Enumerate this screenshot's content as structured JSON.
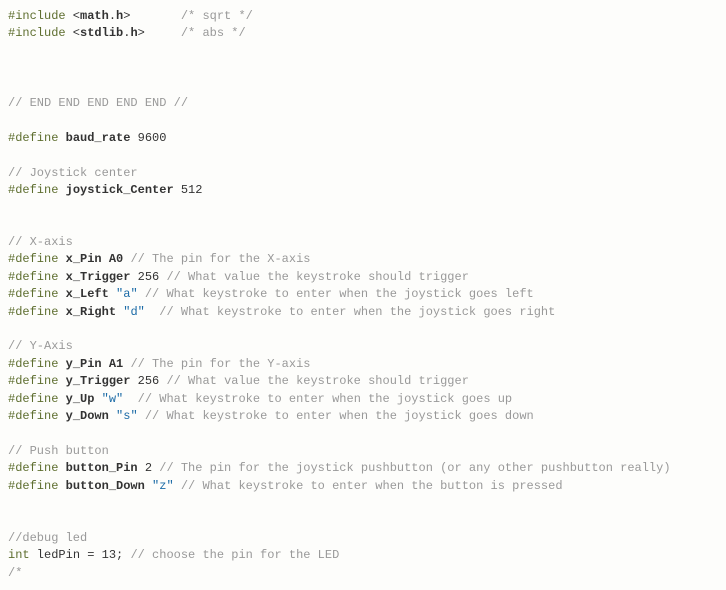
{
  "lines": [
    {
      "parts": [
        {
          "cls": "kw",
          "t": "#include"
        },
        {
          "cls": "reg",
          "t": " <"
        },
        {
          "cls": "id",
          "t": "math"
        },
        {
          "cls": "reg",
          "t": "."
        },
        {
          "cls": "id",
          "t": "h"
        },
        {
          "cls": "reg",
          "t": ">       "
        },
        {
          "cls": "cm",
          "t": "/* sqrt */"
        }
      ]
    },
    {
      "parts": [
        {
          "cls": "kw",
          "t": "#include"
        },
        {
          "cls": "reg",
          "t": " <"
        },
        {
          "cls": "id",
          "t": "stdlib"
        },
        {
          "cls": "reg",
          "t": "."
        },
        {
          "cls": "id",
          "t": "h"
        },
        {
          "cls": "reg",
          "t": ">     "
        },
        {
          "cls": "cm",
          "t": "/* abs */"
        }
      ]
    },
    {
      "parts": []
    },
    {
      "parts": []
    },
    {
      "parts": []
    },
    {
      "parts": [
        {
          "cls": "cm",
          "t": "// END END END END END //"
        }
      ]
    },
    {
      "parts": []
    },
    {
      "parts": [
        {
          "cls": "kw",
          "t": "#define"
        },
        {
          "cls": "reg",
          "t": " "
        },
        {
          "cls": "id",
          "t": "baud_rate"
        },
        {
          "cls": "reg",
          "t": " 9600"
        }
      ]
    },
    {
      "parts": []
    },
    {
      "parts": [
        {
          "cls": "cm",
          "t": "// Joystick center"
        }
      ]
    },
    {
      "parts": [
        {
          "cls": "kw",
          "t": "#define"
        },
        {
          "cls": "reg",
          "t": " "
        },
        {
          "cls": "id",
          "t": "joystick_Center"
        },
        {
          "cls": "reg",
          "t": " 512"
        }
      ]
    },
    {
      "parts": []
    },
    {
      "parts": []
    },
    {
      "parts": [
        {
          "cls": "cm",
          "t": "// X-axis"
        }
      ]
    },
    {
      "parts": [
        {
          "cls": "kw",
          "t": "#define"
        },
        {
          "cls": "reg",
          "t": " "
        },
        {
          "cls": "id",
          "t": "x_Pin"
        },
        {
          "cls": "reg",
          "t": " "
        },
        {
          "cls": "id",
          "t": "A0"
        },
        {
          "cls": "reg",
          "t": " "
        },
        {
          "cls": "cm",
          "t": "// The pin for the X-axis"
        }
      ]
    },
    {
      "parts": [
        {
          "cls": "kw",
          "t": "#define"
        },
        {
          "cls": "reg",
          "t": " "
        },
        {
          "cls": "id",
          "t": "x_Trigger"
        },
        {
          "cls": "reg",
          "t": " 256 "
        },
        {
          "cls": "cm",
          "t": "// What value the keystroke should trigger"
        }
      ]
    },
    {
      "parts": [
        {
          "cls": "kw",
          "t": "#define"
        },
        {
          "cls": "reg",
          "t": " "
        },
        {
          "cls": "id",
          "t": "x_Left"
        },
        {
          "cls": "reg",
          "t": " "
        },
        {
          "cls": "str",
          "t": "\"a\""
        },
        {
          "cls": "reg",
          "t": " "
        },
        {
          "cls": "cm",
          "t": "// What keystroke to enter when the joystick goes left"
        }
      ]
    },
    {
      "parts": [
        {
          "cls": "kw",
          "t": "#define"
        },
        {
          "cls": "reg",
          "t": " "
        },
        {
          "cls": "id",
          "t": "x_Right"
        },
        {
          "cls": "reg",
          "t": " "
        },
        {
          "cls": "str",
          "t": "\"d\""
        },
        {
          "cls": "reg",
          "t": "  "
        },
        {
          "cls": "cm",
          "t": "// What keystroke to enter when the joystick goes right"
        }
      ]
    },
    {
      "parts": []
    },
    {
      "parts": [
        {
          "cls": "cm",
          "t": "// Y-Axis"
        }
      ]
    },
    {
      "parts": [
        {
          "cls": "kw",
          "t": "#define"
        },
        {
          "cls": "reg",
          "t": " "
        },
        {
          "cls": "id",
          "t": "y_Pin"
        },
        {
          "cls": "reg",
          "t": " "
        },
        {
          "cls": "id",
          "t": "A1"
        },
        {
          "cls": "reg",
          "t": " "
        },
        {
          "cls": "cm",
          "t": "// The pin for the Y-axis"
        }
      ]
    },
    {
      "parts": [
        {
          "cls": "kw",
          "t": "#define"
        },
        {
          "cls": "reg",
          "t": " "
        },
        {
          "cls": "id",
          "t": "y_Trigger"
        },
        {
          "cls": "reg",
          "t": " 256 "
        },
        {
          "cls": "cm",
          "t": "// What value the keystroke should trigger"
        }
      ]
    },
    {
      "parts": [
        {
          "cls": "kw",
          "t": "#define"
        },
        {
          "cls": "reg",
          "t": " "
        },
        {
          "cls": "id",
          "t": "y_Up"
        },
        {
          "cls": "reg",
          "t": " "
        },
        {
          "cls": "str",
          "t": "\"w\""
        },
        {
          "cls": "reg",
          "t": "  "
        },
        {
          "cls": "cm",
          "t": "// What keystroke to enter when the joystick goes up"
        }
      ]
    },
    {
      "parts": [
        {
          "cls": "kw",
          "t": "#define"
        },
        {
          "cls": "reg",
          "t": " "
        },
        {
          "cls": "id",
          "t": "y_Down"
        },
        {
          "cls": "reg",
          "t": " "
        },
        {
          "cls": "str",
          "t": "\"s\""
        },
        {
          "cls": "reg",
          "t": " "
        },
        {
          "cls": "cm",
          "t": "// What keystroke to enter when the joystick goes down"
        }
      ]
    },
    {
      "parts": []
    },
    {
      "parts": [
        {
          "cls": "cm",
          "t": "// Push button"
        }
      ]
    },
    {
      "parts": [
        {
          "cls": "kw",
          "t": "#define"
        },
        {
          "cls": "reg",
          "t": " "
        },
        {
          "cls": "id",
          "t": "button_Pin"
        },
        {
          "cls": "reg",
          "t": " 2 "
        },
        {
          "cls": "cm",
          "t": "// The pin for the joystick pushbutton (or any other pushbutton really)"
        }
      ]
    },
    {
      "parts": [
        {
          "cls": "kw",
          "t": "#define"
        },
        {
          "cls": "reg",
          "t": " "
        },
        {
          "cls": "id",
          "t": "button_Down"
        },
        {
          "cls": "reg",
          "t": " "
        },
        {
          "cls": "str",
          "t": "\"z\""
        },
        {
          "cls": "reg",
          "t": " "
        },
        {
          "cls": "cm",
          "t": "// What keystroke to enter when the button is pressed"
        }
      ]
    },
    {
      "parts": []
    },
    {
      "parts": []
    },
    {
      "parts": [
        {
          "cls": "cm",
          "t": "//debug led"
        }
      ]
    },
    {
      "parts": [
        {
          "cls": "kw",
          "t": "int"
        },
        {
          "cls": "reg",
          "t": " ledPin = 13; "
        },
        {
          "cls": "cm",
          "t": "// choose the pin for the LED"
        }
      ]
    },
    {
      "parts": [
        {
          "cls": "cm",
          "t": "/*"
        }
      ]
    }
  ]
}
